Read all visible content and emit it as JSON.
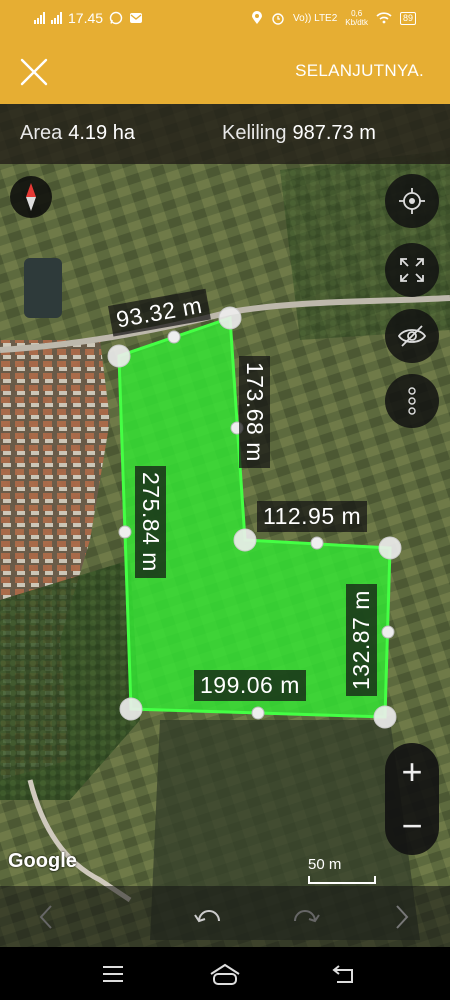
{
  "status_bar": {
    "time": "17.45",
    "network_speed": "0,6",
    "network_unit": "Kb/dtk",
    "network_type": "Vo)) LTE2",
    "battery": "89"
  },
  "app_bar": {
    "close_icon": "close-icon",
    "next_label": "SELANJUTNYA."
  },
  "measurement": {
    "area_label": "Area",
    "area_value": "4.19 ha",
    "perimeter_label": "Keliling",
    "perimeter_value": "987.73 m"
  },
  "polygon": {
    "fill_color": "#33e633",
    "stroke_color": "#44ff44",
    "segments": [
      "93.32 m",
      "173.68 m",
      "112.95 m",
      "132.87 m",
      "199.06 m",
      "275.84 m"
    ]
  },
  "map_controls": {
    "locate": "crosshair-icon",
    "fullscreen": "expand-icon",
    "visibility": "eye-off-icon",
    "more": "more-vertical-icon",
    "compass": "compass-icon",
    "zoom_in": "+",
    "zoom_out": "−"
  },
  "attribution": "Google",
  "scale_label": "50 m"
}
